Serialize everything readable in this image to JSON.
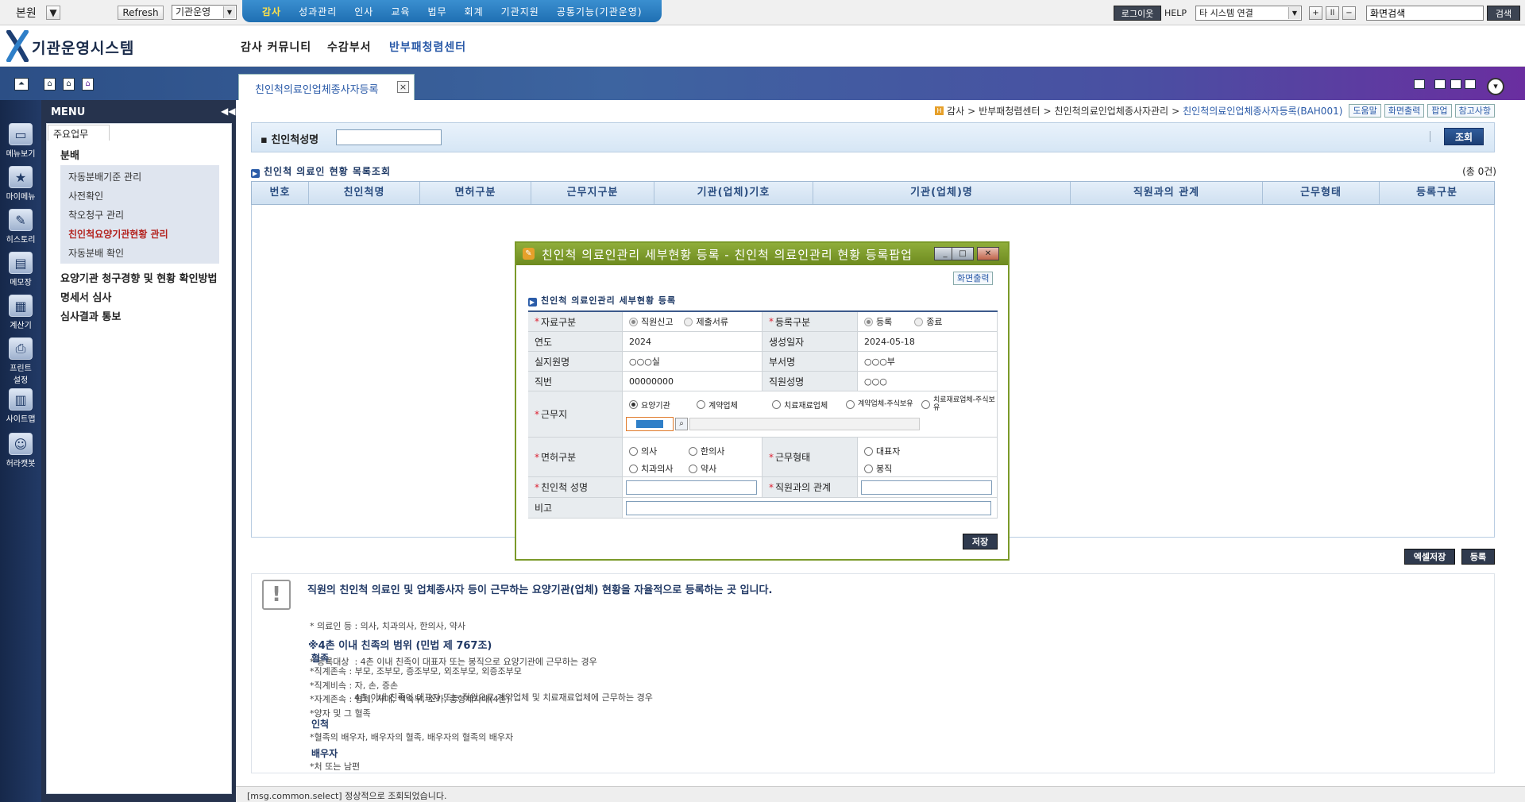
{
  "topbar": {
    "org_label": "본원",
    "refresh": "Refresh",
    "org_select": "기관운영",
    "menu": [
      "감사",
      "성과관리",
      "인사",
      "교육",
      "법무",
      "회계",
      "기관지원",
      "공통기능(기관운영)"
    ],
    "logout": "로그이웃",
    "help": "HELP",
    "system_select": "타 시스템 연결",
    "zoom_plus": "+",
    "zoom_reset": "ll",
    "zoom_minus": "−",
    "screen_search_value": "화면검색",
    "search_btn": "검색"
  },
  "header": {
    "logo_text": "기관운영시스템",
    "nav": [
      "감사 커뮤니티",
      "수감부서",
      "반부패청렴센터"
    ]
  },
  "tab": {
    "label": "친인척의료인업체종사자등록",
    "close": "×"
  },
  "rail": [
    {
      "label": "메뉴보기",
      "icon": "monitor-icon",
      "glyph": "▭"
    },
    {
      "label": "마이메뉴",
      "icon": "star-icon",
      "glyph": "★"
    },
    {
      "label": "히스토리",
      "icon": "pencil-icon",
      "glyph": "✎"
    },
    {
      "label": "메모장",
      "icon": "memo-icon",
      "glyph": "▤"
    },
    {
      "label": "계산기",
      "icon": "calculator-icon",
      "glyph": "▦"
    },
    {
      "label": "프린트",
      "label2": "설정",
      "icon": "printer-icon",
      "glyph": "⎙"
    },
    {
      "label": "사이트맵",
      "icon": "sitemap-icon",
      "glyph": "▥"
    },
    {
      "label": "허라캣봇",
      "icon": "chatbot-icon",
      "glyph": "☺"
    }
  ],
  "menu": {
    "title": "MENU",
    "tab": "주요업무",
    "group1": "분배",
    "subitems": [
      "자동분배기준 관리",
      "사전확인",
      "착오청구 관리",
      "친인척요양기관현황 관리",
      "자동분배 확인"
    ],
    "group2": "요양기관 청구경향 및 현황 확인방법",
    "group3": "명세서 심사",
    "group4": "심사결과 통보"
  },
  "breadcrumb": {
    "items": [
      "감사",
      "반부패청렴센터",
      "친인척의료인업체종사자관리",
      "친인척의료인업체종사자등록(BAH001)"
    ],
    "sep": ">",
    "buttons": [
      "도움말",
      "화면출력",
      "팝업",
      "참고사항"
    ]
  },
  "search": {
    "label": "친인척성명",
    "value": "",
    "button": "조회"
  },
  "list": {
    "title": "친인척 의료인 현황 목록조회",
    "total": "(총 0건)",
    "columns": [
      "번호",
      "친인척명",
      "면허구분",
      "근무지구분",
      "기관(업체)기호",
      "기관(업체)명",
      "직원과의 관계",
      "근무형태",
      "등록구분"
    ],
    "excel_btn": "엑셀저장",
    "register_btn": "등록"
  },
  "info": {
    "main": "직원의 친인척 의료인 및 업체종사자 등이 근무하는 요양기관(업체) 현황을 자율적으로 등록하는 곳 입니다.",
    "lines1": [
      "* 의료인 등 : 의사, 치과의사, 한의사, 약사",
      "* 등록대상  : 4촌 이내 친족이 대표자 또는 봉직으로 요양기관에 근무하는 경우",
      "                4촌 이내 친족이 대표자 또는 직원으로 계약업체 및 치료재료업체에 근무하는 경우"
    ],
    "range_title": "※4촌 이내 친족의 범위 (민법 제 767조)",
    "blood_title": "혈족",
    "blood_lines": [
      "*직계존속  : 부모, 조부모, 증조부모, 외조부모, 외증조부모",
      "*직계비속  : 자, 손, 증손",
      "*자계존속  : 형제, 자매, 백숙부, 조카, 종형제자매(4촌)",
      "*양자 및 그 혈족"
    ],
    "inlaw_title": "인척",
    "inlaw_lines": [
      "*혈족의 배우자, 배우자의 혈족, 배우자의 혈족의 배우자"
    ],
    "spouse_title": "배우자",
    "spouse_lines": [
      "*처 또는 남편"
    ]
  },
  "status": "[msg.common.select] 정상적으로 조회되었습니다.",
  "popup": {
    "title": "친인척 의료인관리 세부현황 등록 - 친인척 의료인관리 현황 등록팝업",
    "print_btn": "화면출력",
    "section": "친인척 의료인관리 세부현황 등록",
    "req_mark": "*",
    "labels": {
      "data_type": "자료구분",
      "reg_type": "등록구분",
      "year": "연도",
      "created": "생성일자",
      "office": "실지원명",
      "dept": "부서명",
      "position": "직번",
      "emp_name": "직원성명",
      "workplace": "근무지",
      "license": "면허구분",
      "work_type": "근무형태",
      "rel_name": "친인척 성명",
      "relation": "직원과의 관계",
      "note": "비고"
    },
    "values": {
      "data_type_opts": [
        "직원신고",
        "제출서류"
      ],
      "reg_type_opts": [
        "등록",
        "종료"
      ],
      "year": "2024",
      "created": "2024-05-18",
      "office": "○○○실",
      "dept": "○○○부",
      "position": "00000000",
      "emp_name": "○○○",
      "workplace_opts": [
        "요양기관",
        "계약업체",
        "치료재료업체",
        "계약업체-주식보유",
        "치료재료업체-주식보유"
      ],
      "license_opts": [
        "의사",
        "한의사",
        "치과의사",
        "약사"
      ],
      "work_type_opts": [
        "대표자",
        "봉직"
      ]
    },
    "save_btn": "저장"
  }
}
